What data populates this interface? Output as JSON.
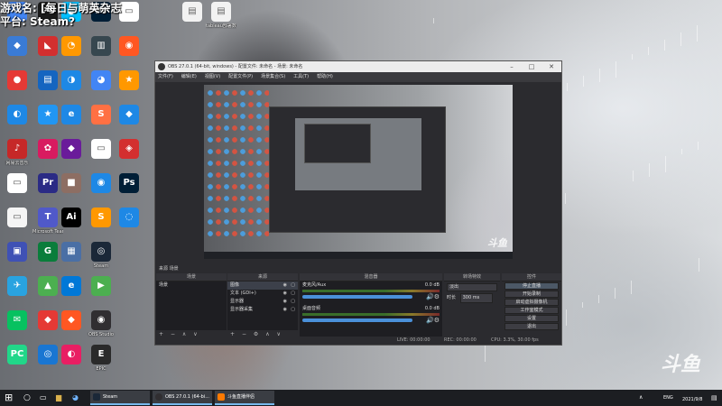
{
  "overlay": {
    "game_line": "游戏名: [每日与萌英杂志",
    "platform_line": "平台: Steam?"
  },
  "desktop_icons": [
    {
      "label": "",
      "color": "#4285f4",
      "glyph": "⚙"
    },
    {
      "label": "",
      "color": "#3a7bd5",
      "glyph": "◆"
    },
    {
      "label": "",
      "color": "#e53935",
      "glyph": "●"
    },
    {
      "label": "",
      "color": "#1e88e5",
      "glyph": "◐"
    },
    {
      "label": "网易云音乐",
      "color": "#c62828",
      "glyph": "♪"
    },
    {
      "label": "",
      "color": "#ffffff",
      "glyph": "▭"
    },
    {
      "label": "",
      "color": "#f5f5f5",
      "glyph": "▭"
    },
    {
      "label": "",
      "color": "#3f51b5",
      "glyph": "▣"
    },
    {
      "label": "",
      "color": "#29a3e0",
      "glyph": "✈"
    },
    {
      "label": "",
      "color": "#07c160",
      "glyph": "✉"
    },
    {
      "label": "",
      "color": "#21d789",
      "glyph": "PC"
    },
    {
      "label": "",
      "color": "#1a1a1a",
      "glyph": "PC"
    },
    {
      "label": "",
      "color": "#d32f2f",
      "glyph": "◣"
    },
    {
      "label": "",
      "color": "#1565c0",
      "glyph": "▤"
    },
    {
      "label": "",
      "color": "#2196f3",
      "glyph": "★"
    },
    {
      "label": "",
      "color": "#d81b60",
      "glyph": "✿"
    },
    {
      "label": "",
      "color": "#2b2b85",
      "glyph": "Pr"
    },
    {
      "label": "Microsoft Teams",
      "color": "#5059c9",
      "glyph": "T"
    },
    {
      "label": "",
      "color": "#0a7d3b",
      "glyph": "G"
    },
    {
      "label": "",
      "color": "#4caf50",
      "glyph": "▲"
    },
    {
      "label": "",
      "color": "#e53935",
      "glyph": "◆"
    },
    {
      "label": "",
      "color": "#1976d2",
      "glyph": "◎"
    },
    {
      "label": "",
      "color": "#00c0ff",
      "glyph": "◒"
    },
    {
      "label": "",
      "color": "#ff9800",
      "glyph": "◔"
    },
    {
      "label": "",
      "color": "#1e88e5",
      "glyph": "◑"
    },
    {
      "label": "",
      "color": "#1e88e5",
      "glyph": "e"
    },
    {
      "label": "",
      "color": "#6a1b9a",
      "glyph": "◆"
    },
    {
      "label": "",
      "color": "#8d6e63",
      "glyph": "■"
    },
    {
      "label": "",
      "color": "#000000",
      "glyph": "Ai"
    },
    {
      "label": "",
      "color": "#4a6fa5",
      "glyph": "▦"
    },
    {
      "label": "",
      "color": "#0078d7",
      "glyph": "e"
    },
    {
      "label": "",
      "color": "#ff5722",
      "glyph": "◆"
    },
    {
      "label": "",
      "color": "#e91e63",
      "glyph": "◐"
    },
    {
      "label": "",
      "color": "#001e36",
      "glyph": "Ps"
    },
    {
      "label": "",
      "color": "#37474f",
      "glyph": "▥"
    },
    {
      "label": "",
      "color": "#4285f4",
      "glyph": "◕"
    },
    {
      "label": "",
      "color": "#ff7043",
      "glyph": "S"
    },
    {
      "label": "",
      "color": "#ffffff",
      "glyph": "▭"
    },
    {
      "label": "",
      "color": "#1e88e5",
      "glyph": "◉"
    },
    {
      "label": "",
      "color": "#ff9800",
      "glyph": "S"
    },
    {
      "label": "Steam",
      "color": "#1b2838",
      "glyph": "◎"
    },
    {
      "label": "",
      "color": "#4caf50",
      "glyph": "▶"
    },
    {
      "label": "OBS Studio",
      "color": "#302e31",
      "glyph": "◉"
    },
    {
      "label": "EPIC",
      "color": "#2a2a2a",
      "glyph": "E"
    },
    {
      "label": "",
      "color": "#ffffff",
      "glyph": "▭"
    },
    {
      "label": "",
      "color": "#ff5722",
      "glyph": "◉"
    },
    {
      "label": "",
      "color": "#ff9800",
      "glyph": "★"
    },
    {
      "label": "",
      "color": "#1e88e5",
      "glyph": "◆"
    },
    {
      "label": "",
      "color": "#d32f2f",
      "glyph": "◈"
    },
    {
      "label": "",
      "color": "#001e36",
      "glyph": "Ps"
    },
    {
      "label": "",
      "color": "#1e88e5",
      "glyph": "◌"
    },
    {
      "label": "",
      "color": "#ff7043",
      "glyph": "S"
    },
    {
      "label": "",
      "color": "#fdd835",
      "glyph": "▣"
    },
    {
      "label": "",
      "color": "#1e88e5",
      "glyph": "◆"
    },
    {
      "label": "",
      "color": "#ff9800",
      "glyph": "S"
    },
    {
      "label": "",
      "color": "#e53935",
      "glyph": "◉"
    },
    {
      "label": "",
      "color": "#2196f3",
      "glyph": "▲"
    }
  ],
  "top_files": [
    {
      "label": "",
      "glyph": "▤"
    },
    {
      "label": "tableau部署数据",
      "glyph": "▤"
    }
  ],
  "obs": {
    "title": "OBS 27.0.1 (64-bit, windows) - 配置文件: 未命名 - 场景: 未命名",
    "menu": [
      "文件(F)",
      "编辑(E)",
      "视图(V)",
      "配置文件(P)",
      "场景集合(S)",
      "工具(T)",
      "帮助(H)"
    ],
    "docks": {
      "scenes": {
        "title": "来源 场景",
        "header": "场景",
        "items": [
          "场景"
        ],
        "foot": [
          "+",
          "−",
          "∧",
          "∨"
        ]
      },
      "sources": {
        "title": "",
        "header": "来源",
        "items": [
          "图像",
          "文本 (GDI+)",
          "显示器",
          "显示器采集"
        ],
        "foot": [
          "+",
          "−",
          "⚙",
          "∧",
          "∨"
        ]
      },
      "mixer": {
        "header": "混音器",
        "items": [
          {
            "name": "麦克风/Aux",
            "db": "0.0 dB"
          },
          {
            "name": "桌面音频",
            "db": "0.0 dB"
          }
        ]
      },
      "transitions": {
        "header": "转场特效",
        "type": "淡出",
        "duration_label": "时长",
        "duration": "300 ms"
      },
      "controls": {
        "header": "控件",
        "buttons": [
          "停止直播",
          "开始录制",
          "启动虚拟摄像机",
          "工作室模式",
          "设置",
          "退出"
        ]
      }
    },
    "status": {
      "live": "LIVE: 00:00:00",
      "rec": "REC: 00:00:00",
      "cpu": "CPU: 3.3%, 30.00 fps"
    }
  },
  "watermarks": {
    "preview": "斗鱼",
    "bottom": "斗鱼"
  },
  "taskbar": {
    "apps": [
      {
        "label": "Steam",
        "color": "#1b2838"
      },
      {
        "label": "OBS 27.0.1 (64-bi...",
        "color": "#302e31"
      },
      {
        "label": "斗鱼直播伴侣",
        "color": "#ff7a00"
      }
    ],
    "tray": {
      "lang": "ENG",
      "time": "",
      "date": "2021/9/8"
    }
  }
}
